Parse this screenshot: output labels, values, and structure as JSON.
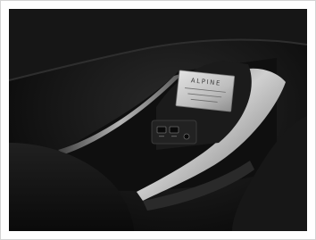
{
  "photo": {
    "plate_brand": "ALPINE",
    "plate_lines": [
      "",
      "",
      ""
    ]
  },
  "colors": {
    "trim_metal": "#a9a9a9",
    "plate_metal": "#cfcfcf",
    "dark_leather": "#1a1a1a"
  }
}
